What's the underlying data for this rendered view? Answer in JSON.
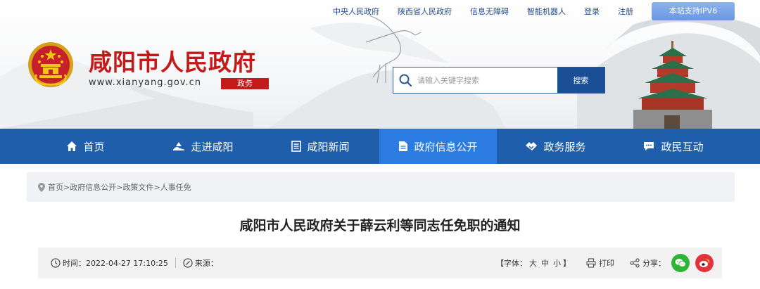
{
  "colors": {
    "brand_red": "#c41a1a",
    "nav_blue": "#1f5eab",
    "nav_active": "#2c7be0",
    "top_link": "#234b8b"
  },
  "topbar": {
    "links": [
      "中央人民政府",
      "陕西省人民政府",
      "信息无障碍",
      "智能机器人",
      "登录",
      "注册"
    ],
    "ipv6_label": "本站支持IPV6"
  },
  "site": {
    "title": "咸阳市人民政府",
    "url": "www.xianyang.gov.cn",
    "badge": "政务",
    "emblem_icon": "national-emblem"
  },
  "search": {
    "placeholder": "请输入关键字搜索",
    "button_label": "搜索",
    "icon": "search-icon"
  },
  "nav": {
    "items": [
      {
        "label": "首页",
        "icon": "home-icon"
      },
      {
        "label": "走进咸阳",
        "icon": "landmark-icon"
      },
      {
        "label": "咸阳新闻",
        "icon": "newspaper-icon"
      },
      {
        "label": "政府信息公开",
        "icon": "document-icon",
        "active": true
      },
      {
        "label": "政务服务",
        "icon": "handshake-icon"
      },
      {
        "label": "政民互动",
        "icon": "chat-icon"
      }
    ]
  },
  "breadcrumb": {
    "icon": "location-pin-icon",
    "items": [
      "首页",
      "政府信息公开",
      "政策文件",
      "人事任免"
    ],
    "separator": ">"
  },
  "article": {
    "title": "咸阳市人民政府关于薛云利等同志任免职的通知",
    "time_label": "时间：",
    "time_value": "2022-04-27 17:10:25",
    "source_label": "来源：",
    "source_value": "",
    "font_label_open": "【字体：",
    "font_sizes": [
      "大",
      "中",
      "小"
    ],
    "font_label_close": "】",
    "print_label": "打印",
    "share_label": "分享："
  }
}
